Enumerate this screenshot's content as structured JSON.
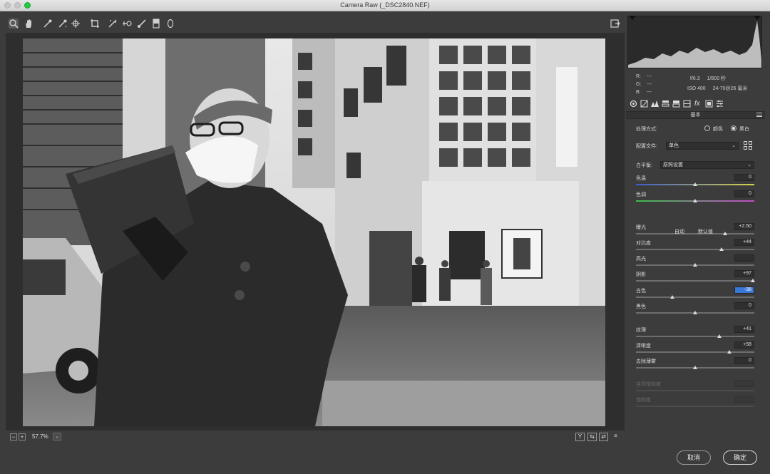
{
  "window": {
    "title": "Camera Raw (_DSC2840.NEF)"
  },
  "toolbar": {
    "tools": [
      "zoom-icon",
      "hand-icon",
      "white-balance-icon",
      "color-sampler-icon",
      "target-adjust-icon",
      "crop-icon",
      "straighten-icon",
      "spot-removal-icon",
      "brush-icon",
      "graduated-filter-icon",
      "radial-filter-icon"
    ],
    "open_preferences": "export-icon"
  },
  "status": {
    "zoom": "57.7%",
    "view_buttons": [
      "Y",
      "⇆",
      "⇄",
      "≡"
    ]
  },
  "info": {
    "r_label": "R:",
    "g_label": "G:",
    "b_label": "B:",
    "r_value": "---",
    "g_value": "---",
    "b_value": "---",
    "aperture": "f/6.3",
    "shutter": "1/800 秒",
    "iso": "ISO 400",
    "lens": "24-70@26 毫米"
  },
  "panel": {
    "section_title": "基本",
    "treatment_label": "处理方式:",
    "treatment_color": "颜色",
    "treatment_bw": "黑白",
    "profile_label": "配置文件:",
    "profile_value": "单色",
    "wb_label": "白平衡:",
    "wb_value": "原照设置",
    "auto_label": "自动",
    "default_label": "默认值"
  },
  "sliders": [
    {
      "label": "色温",
      "value": "0",
      "pos": 0.5
    },
    {
      "label": "色调",
      "value": "0",
      "pos": 0.5
    },
    {
      "label": "曝光",
      "value": "+2.50",
      "pos": 0.75
    },
    {
      "label": "对比度",
      "value": "+44",
      "pos": 0.72
    },
    {
      "label": "高光",
      "value": "",
      "pos": 0.5
    },
    {
      "label": "阴影",
      "value": "+97",
      "pos": 0.985
    },
    {
      "label": "白色",
      "value": "-38",
      "pos": 0.31
    },
    {
      "label": "黑色",
      "value": "0",
      "pos": 0.5
    },
    {
      "label": "纹理",
      "value": "+41",
      "pos": 0.705
    },
    {
      "label": "清晰度",
      "value": "+58",
      "pos": 0.79
    },
    {
      "label": "去除薄雾",
      "value": "0",
      "pos": 0.5
    },
    {
      "label": "自然饱和度",
      "value": "",
      "pos": 0.5
    },
    {
      "label": "饱和度",
      "value": "",
      "pos": 0.5
    }
  ],
  "buttons": {
    "cancel": "取消",
    "ok": "确定"
  },
  "colors": {
    "selection": "#3a78d8",
    "panel_bg": "#3c3c3c",
    "window_bg": "#2e2e2e"
  }
}
